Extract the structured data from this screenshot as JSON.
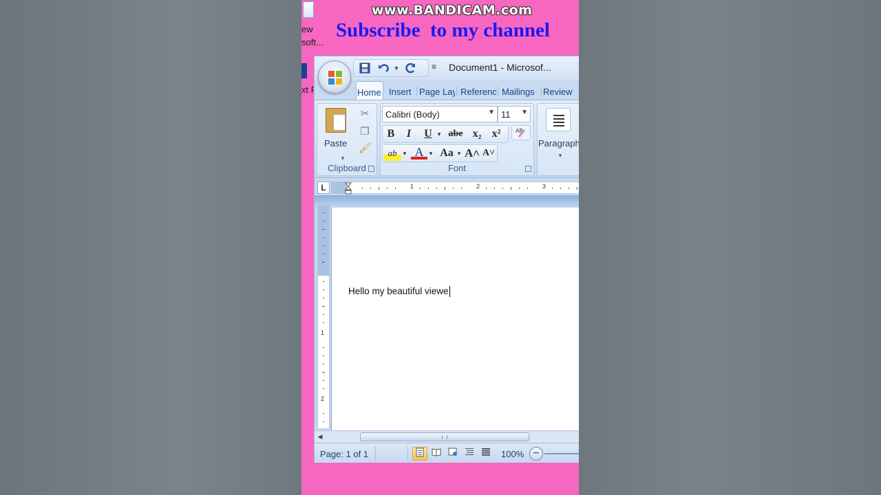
{
  "overlay": {
    "watermark": "www.BANDICAM.com",
    "subscribe": "Subscribe  to my channel"
  },
  "desktop": {
    "icon_labels": [
      "ew",
      "soft...",
      "xt P"
    ]
  },
  "window": {
    "title": "Document1 - Microsof...",
    "qat": {
      "save_icon": "save-icon",
      "undo_icon": "undo-icon",
      "redo_icon": "redo-icon",
      "customize": "≡"
    }
  },
  "tabs": [
    "Home",
    "Insert",
    "Page Lay",
    "Referenc",
    "Mailings",
    "Review"
  ],
  "ribbon": {
    "clipboard": {
      "paste_label": "Paste",
      "group_label": "Clipboard"
    },
    "font": {
      "font_name": "Calibri (Body)",
      "font_size": "11",
      "bold": "B",
      "italic": "I",
      "underline": "U",
      "strike": "abe",
      "subscript": "x₂",
      "superscript": "x²",
      "highlight": "ab",
      "font_color": "A",
      "change_case": "Aa",
      "grow": "A˄",
      "shrink": "A˅",
      "group_label": "Font"
    },
    "paragraph": {
      "group_label": "Paragraph"
    }
  },
  "ruler": {
    "tab_selector": "L",
    "numbers": [
      "1",
      "2",
      "3"
    ],
    "vertical_numbers": [
      "1",
      "2"
    ]
  },
  "document": {
    "text": "Hello my beautiful viewe"
  },
  "status": {
    "page": "Page: 1 of 1",
    "zoom": "100%",
    "zoom_out": "−"
  },
  "colors": {
    "stage_bg": "#f766c0",
    "subscribe": "#1a1aee",
    "ribbon_text": "#15428b"
  }
}
